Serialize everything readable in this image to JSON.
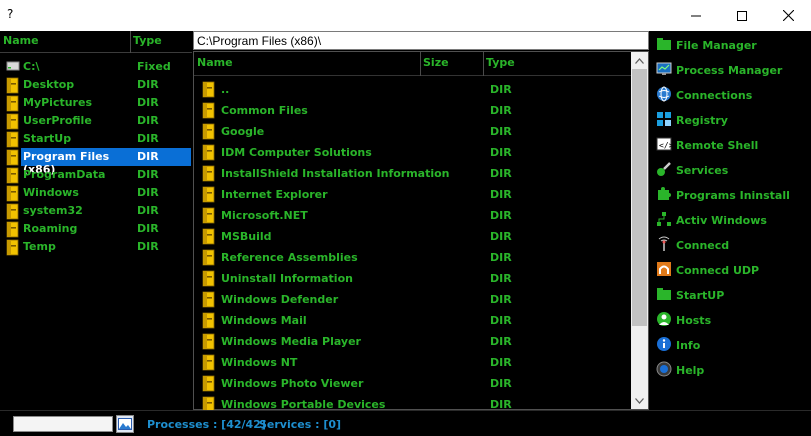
{
  "window": {
    "title": "?"
  },
  "left_pane": {
    "headers": {
      "name": "Name",
      "type": "Type"
    },
    "rows": [
      {
        "name": "C:\\",
        "type": "Fixed",
        "icon": "drive-icon"
      },
      {
        "name": "Desktop",
        "type": "DIR",
        "icon": "folder-icon"
      },
      {
        "name": "MyPictures",
        "type": "DIR",
        "icon": "folder-icon"
      },
      {
        "name": "UserProfile",
        "type": "DIR",
        "icon": "folder-icon"
      },
      {
        "name": "StartUp",
        "type": "DIR",
        "icon": "folder-icon"
      },
      {
        "name": "Program Files (x86)",
        "type": "DIR",
        "icon": "folder-icon",
        "selected": true
      },
      {
        "name": "ProgramData",
        "type": "DIR",
        "icon": "folder-icon"
      },
      {
        "name": "Windows",
        "type": "DIR",
        "icon": "folder-icon"
      },
      {
        "name": "system32",
        "type": "DIR",
        "icon": "folder-icon"
      },
      {
        "name": "Roaming",
        "type": "DIR",
        "icon": "folder-icon"
      },
      {
        "name": "Temp",
        "type": "DIR",
        "icon": "folder-icon"
      }
    ]
  },
  "path": "C:\\Program Files (x86)\\",
  "center_pane": {
    "headers": {
      "name": "Name",
      "size": "Size",
      "type": "Type"
    },
    "rows": [
      {
        "name": "..",
        "type": "DIR"
      },
      {
        "name": "Common Files",
        "type": "DIR"
      },
      {
        "name": "Google",
        "type": "DIR"
      },
      {
        "name": "IDM Computer Solutions",
        "type": "DIR"
      },
      {
        "name": "InstallShield Installation Information",
        "type": "DIR"
      },
      {
        "name": "Internet Explorer",
        "type": "DIR"
      },
      {
        "name": "Microsoft.NET",
        "type": "DIR"
      },
      {
        "name": "MSBuild",
        "type": "DIR"
      },
      {
        "name": "Reference Assemblies",
        "type": "DIR"
      },
      {
        "name": "Uninstall Information",
        "type": "DIR"
      },
      {
        "name": "Windows Defender",
        "type": "DIR"
      },
      {
        "name": "Windows Mail",
        "type": "DIR"
      },
      {
        "name": "Windows Media Player",
        "type": "DIR"
      },
      {
        "name": "Windows NT",
        "type": "DIR"
      },
      {
        "name": "Windows Photo Viewer",
        "type": "DIR"
      },
      {
        "name": "Windows Portable Devices",
        "type": "DIR"
      }
    ]
  },
  "right_menu": [
    {
      "label": "File Manager",
      "icon": "folder-tree-icon"
    },
    {
      "label": "Process Manager",
      "icon": "monitor-icon"
    },
    {
      "label": "Connections",
      "icon": "globe-icon"
    },
    {
      "label": "Registry",
      "icon": "registry-icon"
    },
    {
      "label": "Remote Shell",
      "icon": "terminal-icon"
    },
    {
      "label": "Services",
      "icon": "services-icon"
    },
    {
      "label": "Programs Ininstall",
      "icon": "puzzle-icon"
    },
    {
      "label": "Activ Windows",
      "icon": "windows-tree-icon"
    },
    {
      "label": "Connecd",
      "icon": "antenna-icon"
    },
    {
      "label": "Connecd UDP",
      "icon": "udp-icon"
    },
    {
      "label": "StartUP",
      "icon": "startup-folder-icon"
    },
    {
      "label": "Hosts",
      "icon": "hosts-icon"
    },
    {
      "label": "Info",
      "icon": "info-icon"
    },
    {
      "label": "Help",
      "icon": "help-icon"
    }
  ],
  "status": {
    "processes": "Processes : [42/42]",
    "services": "Services : [0]"
  },
  "colors": {
    "text_green": "#2ab52a",
    "status_blue": "#1e8fcf",
    "folder_yellow": "#f2c200",
    "selection": "#0a6fd6"
  }
}
